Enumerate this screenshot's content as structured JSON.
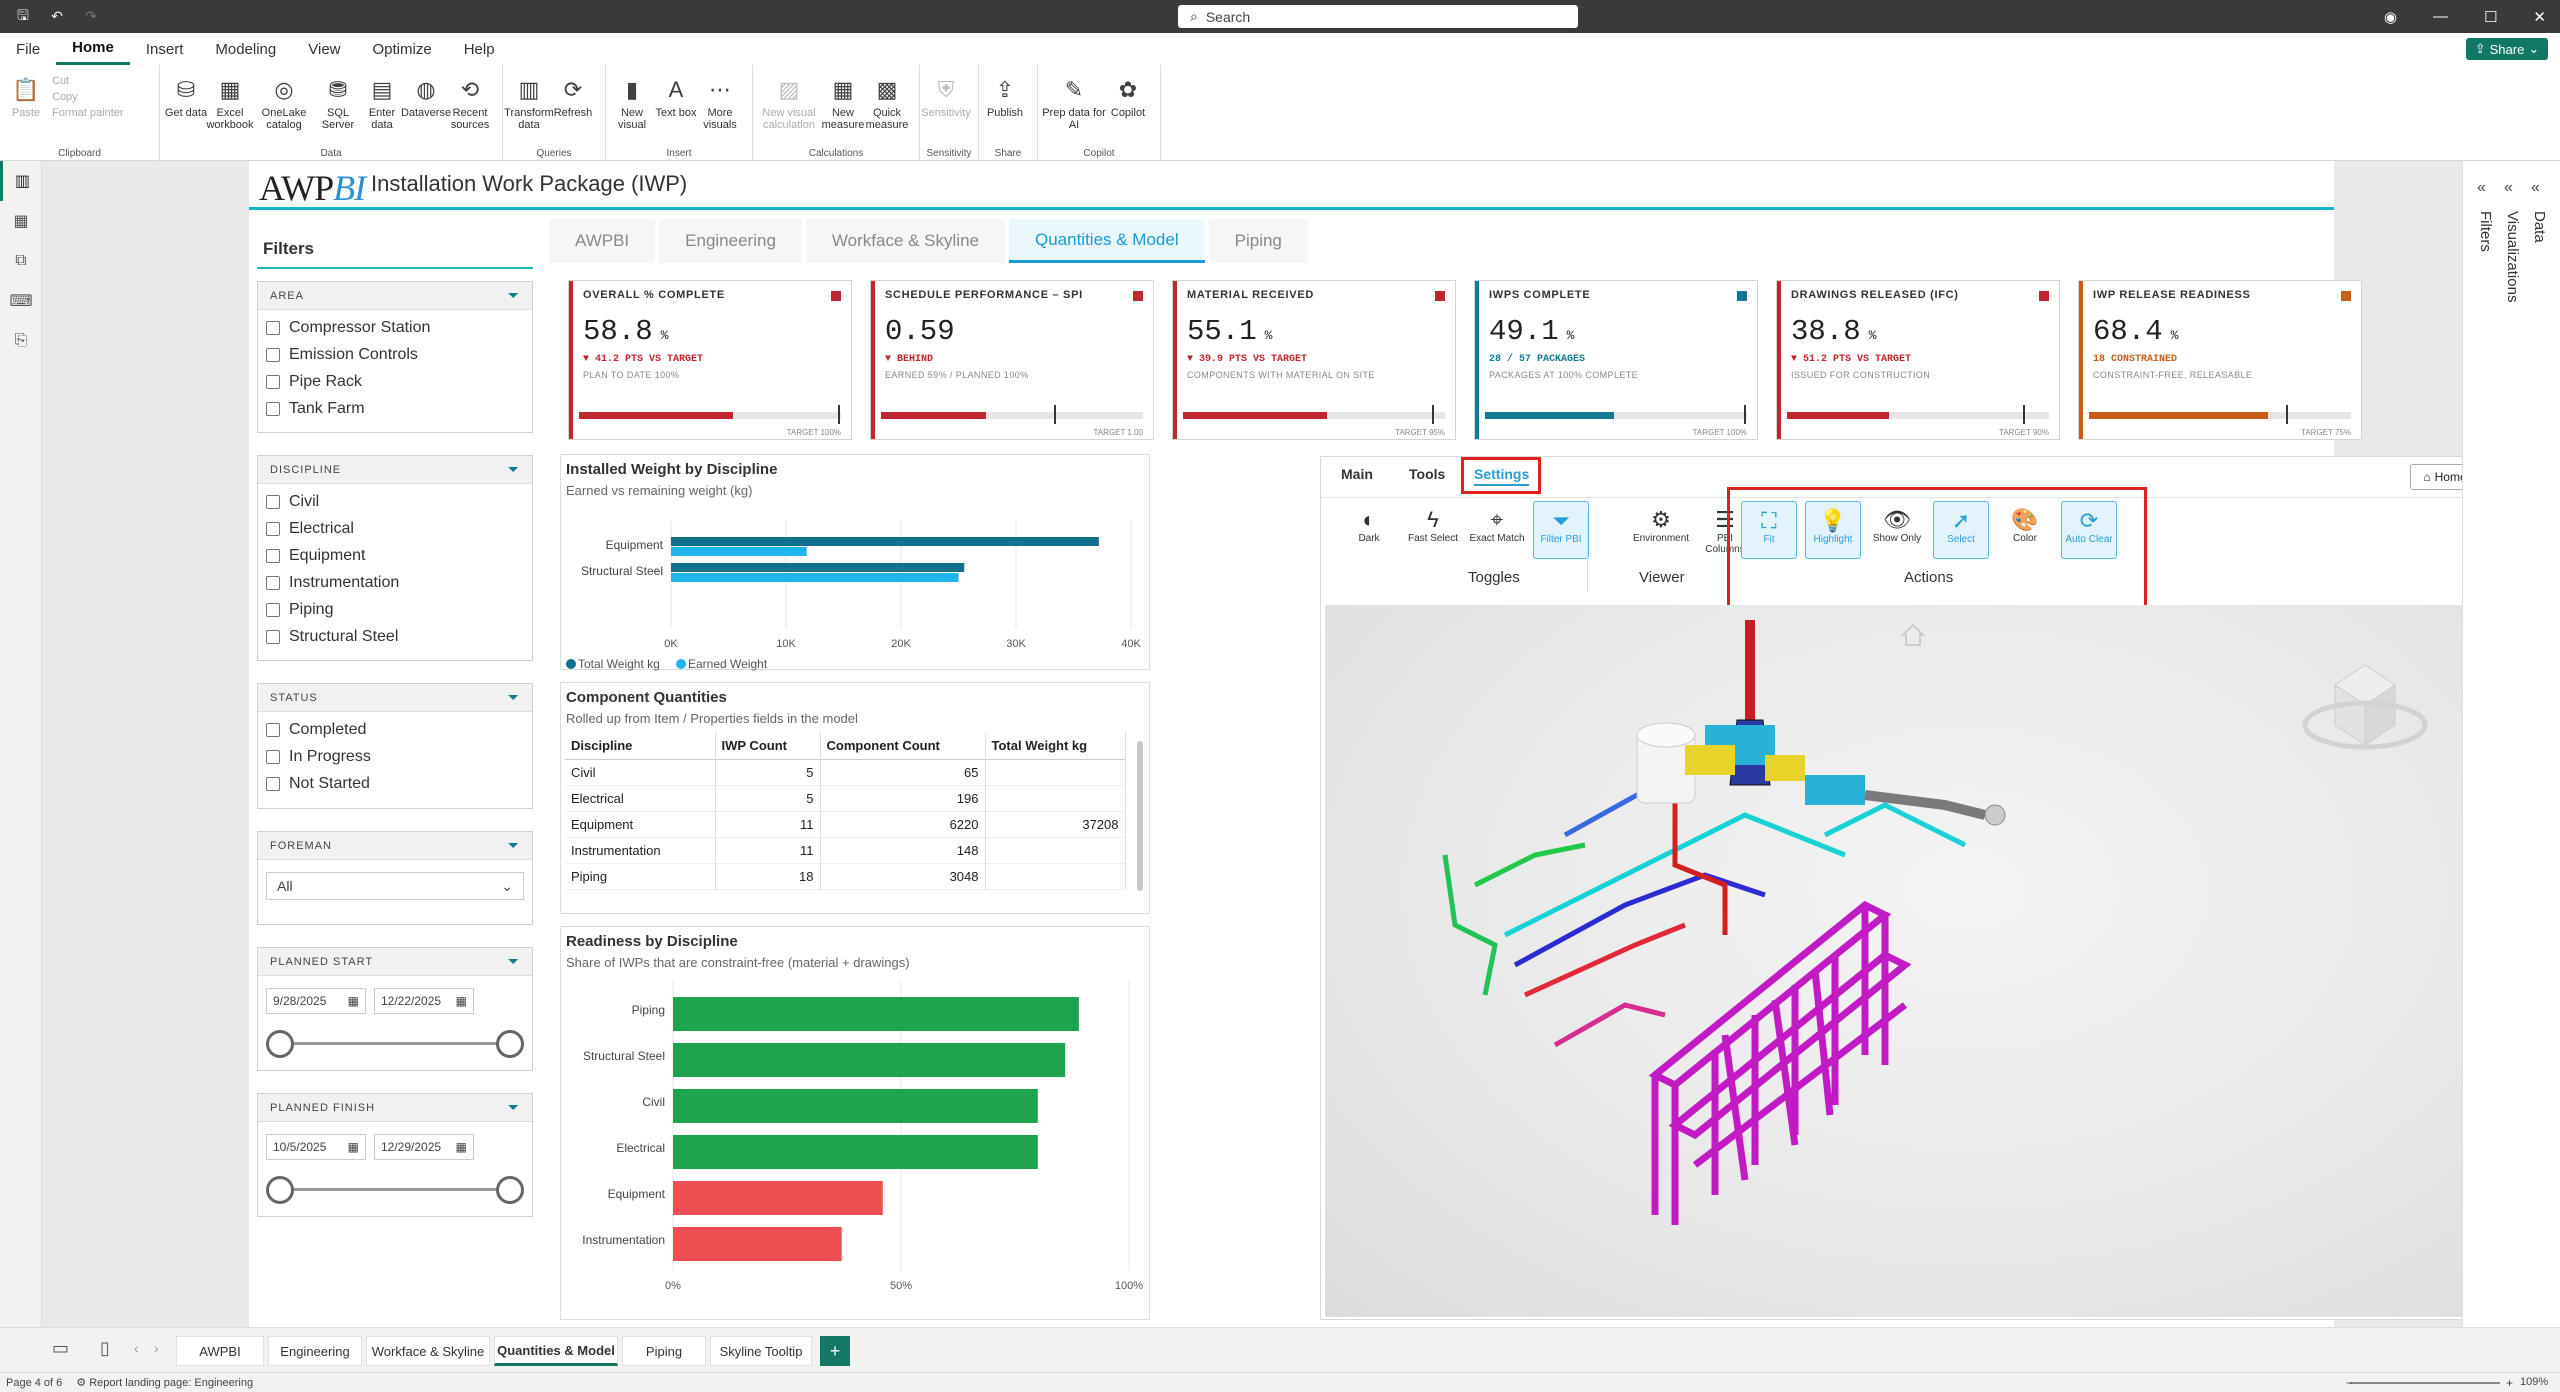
{
  "search_placeholder": "Search",
  "share_label": "Share",
  "menu": [
    "File",
    "Home",
    "Insert",
    "Modeling",
    "View",
    "Optimize",
    "Help"
  ],
  "ribbon": {
    "clipboard": {
      "paste": "Paste",
      "cut": "Cut",
      "copy": "Copy",
      "format_painter": "Format painter",
      "label": "Clipboard"
    },
    "data": {
      "buttons": [
        "Get data",
        "Excel workbook",
        "OneLake catalog",
        "SQL Server",
        "Enter data",
        "Dataverse",
        "Recent sources"
      ],
      "label": "Data"
    },
    "queries": {
      "buttons": [
        "Transform data",
        "Refresh"
      ],
      "label": "Queries"
    },
    "insert": {
      "buttons": [
        "New visual",
        "Text box",
        "More visuals"
      ],
      "label": "Insert"
    },
    "calculations": {
      "buttons": [
        "New visual calculation",
        "New measure",
        "Quick measure"
      ],
      "label": "Calculations"
    },
    "sensitivity": {
      "buttons": [
        "Sensitivity"
      ],
      "label": "Sensitivity"
    },
    "share": {
      "buttons": [
        "Publish"
      ],
      "label": "Share"
    },
    "copilot": {
      "buttons": [
        "Prep data for AI",
        "Copilot"
      ],
      "label": "Copilot"
    }
  },
  "report": {
    "logo_a": "AWP",
    "logo_b": "BI",
    "title": "Installation Work Package (IWP)"
  },
  "filters": {
    "title": "Filters",
    "area": {
      "label": "AREA",
      "items": [
        "Compressor Station",
        "Emission Controls",
        "Pipe Rack",
        "Tank Farm"
      ]
    },
    "discipline": {
      "label": "DISCIPLINE",
      "items": [
        "Civil",
        "Electrical",
        "Equipment",
        "Instrumentation",
        "Piping",
        "Structural Steel"
      ]
    },
    "status": {
      "label": "STATUS",
      "items": [
        "Completed",
        "In Progress",
        "Not Started"
      ]
    },
    "foreman": {
      "label": "FOREMAN",
      "value": "All"
    },
    "planned_start": {
      "label": "PLANNED START",
      "from": "9/28/2025",
      "to": "12/22/2025"
    },
    "planned_finish": {
      "label": "PLANNED FINISH",
      "from": "10/5/2025",
      "to": "12/29/2025"
    }
  },
  "tabs": [
    "AWPBI",
    "Engineering",
    "Workface & Skyline",
    "Quantities & Model",
    "Piping"
  ],
  "active_tab": "Quantities & Model",
  "kpis": [
    {
      "title": "OVERALL % COMPLETE",
      "value": "58.8",
      "unit": "%",
      "delta": "▼ 41.2 PTS VS TARGET",
      "sub": "PLAN TO DATE 100%",
      "target_label": "TARGET 100%",
      "color": "#c0262d",
      "fill": 0.588,
      "target": 0.99
    },
    {
      "title": "SCHEDULE PERFORMANCE – SPI",
      "value": "0.59",
      "unit": "",
      "delta": "▼ BEHIND",
      "sub": "EARNED 59% / PLANNED 100%",
      "target_label": "TARGET 1.00",
      "color": "#c0262d",
      "fill": 0.4,
      "target": 0.66
    },
    {
      "title": "MATERIAL RECEIVED",
      "value": "55.1",
      "unit": "%",
      "delta": "▼ 39.9 PTS VS TARGET",
      "sub": "COMPONENTS WITH MATERIAL ON SITE",
      "target_label": "TARGET 95%",
      "color": "#c0262d",
      "fill": 0.551,
      "target": 0.95
    },
    {
      "title": "IWPS COMPLETE",
      "value": "49.1",
      "unit": "%",
      "delta": "28 / 57 PACKAGES",
      "sub": "PACKAGES AT 100% COMPLETE",
      "target_label": "TARGET 100%",
      "color": "#137a92",
      "fill": 0.491,
      "target": 0.99
    },
    {
      "title": "DRAWINGS RELEASED (IFC)",
      "value": "38.8",
      "unit": "%",
      "delta": "▼ 51.2 PTS VS TARGET",
      "sub": "ISSUED FOR CONSTRUCTION",
      "target_label": "TARGET 90%",
      "color": "#c0262d",
      "fill": 0.388,
      "target": 0.9
    },
    {
      "title": "IWP RELEASE READINESS",
      "value": "68.4",
      "unit": "%",
      "delta": "18 CONSTRAINED",
      "sub": "CONSTRAINT-FREE, RELEASABLE",
      "target_label": "TARGET 75%",
      "color": "#c95d17",
      "fill": 0.684,
      "target": 0.75
    }
  ],
  "weight_chart": {
    "title": "Installed Weight by Discipline",
    "subtitle": "Earned vs remaining weight (kg)",
    "legend": [
      "Total Weight kg",
      "Earned Weight"
    ],
    "colors": [
      "#11708c",
      "#1eb5ec"
    ],
    "ticks": [
      "0K",
      "10K",
      "20K",
      "30K",
      "40K"
    ]
  },
  "chart_data": [
    {
      "type": "bar",
      "categories": [
        "Equipment",
        "Structural Steel"
      ],
      "series": [
        {
          "name": "Total Weight kg",
          "values": [
            37208,
            25500
          ]
        },
        {
          "name": "Earned Weight",
          "values": [
            11800,
            25000
          ]
        }
      ],
      "xlim": [
        0,
        40000
      ],
      "title": "Installed Weight by Discipline"
    },
    {
      "type": "bar",
      "categories": [
        "Piping",
        "Structural Steel",
        "Civil",
        "Electrical",
        "Equipment",
        "Instrumentation"
      ],
      "values": [
        89,
        86,
        80,
        80,
        46,
        37
      ],
      "xlim": [
        0,
        100
      ],
      "title": "Readiness by Discipline"
    }
  ],
  "quantities": {
    "title": "Component Quantities",
    "subtitle": "Rolled up from Item / Properties fields in the model",
    "headers": [
      "Discipline",
      "IWP Count",
      "Component Count",
      "Total Weight kg"
    ],
    "rows": [
      [
        "Civil",
        "5",
        "65",
        ""
      ],
      [
        "Electrical",
        "5",
        "196",
        ""
      ],
      [
        "Equipment",
        "11",
        "6220",
        "37208"
      ],
      [
        "Instrumentation",
        "11",
        "148",
        ""
      ],
      [
        "Piping",
        "18",
        "3048",
        ""
      ]
    ]
  },
  "readiness": {
    "title": "Readiness by Discipline",
    "subtitle": "Share of IWPs that are constraint-free (material + drawings)",
    "ticks": [
      "0%",
      "50%",
      "100%"
    ],
    "good": "#1ea44e",
    "bad": "#ec4e52"
  },
  "viewer": {
    "tabs": [
      "Main",
      "Tools",
      "Settings"
    ],
    "home": "Home",
    "toggles": [
      {
        "label": "Dark",
        "icon": "◐"
      },
      {
        "label": "Fast Select",
        "icon": "ϟ"
      },
      {
        "label": "Exact Match",
        "icon": "⌖"
      },
      {
        "label": "Filter PBI",
        "icon": "⏷"
      }
    ],
    "viewer_btns": [
      {
        "label": "Environment",
        "icon": "⚙"
      },
      {
        "label": "PBI Columns",
        "icon": "☰"
      }
    ],
    "actions": [
      {
        "label": "Fit",
        "icon": "⛶"
      },
      {
        "label": "Highlight",
        "icon": "💡"
      },
      {
        "label": "Show Only",
        "icon": "👁"
      },
      {
        "label": "Select",
        "icon": "➚"
      },
      {
        "label": "Color",
        "icon": "🎨"
      },
      {
        "label": "Auto Clear",
        "icon": "⟳"
      }
    ],
    "groups": [
      "Toggles",
      "Viewer",
      "Actions"
    ]
  },
  "pages": [
    "AWPBI",
    "Engineering",
    "Workface & Skyline",
    "Quantities & Model",
    "Piping",
    "Skyline Tooltip"
  ],
  "status": {
    "page": "Page 4 of 6",
    "landing": "Report landing page: Engineering",
    "zoom": "109%"
  },
  "panes": [
    "Filters",
    "Visualizations",
    "Data"
  ]
}
